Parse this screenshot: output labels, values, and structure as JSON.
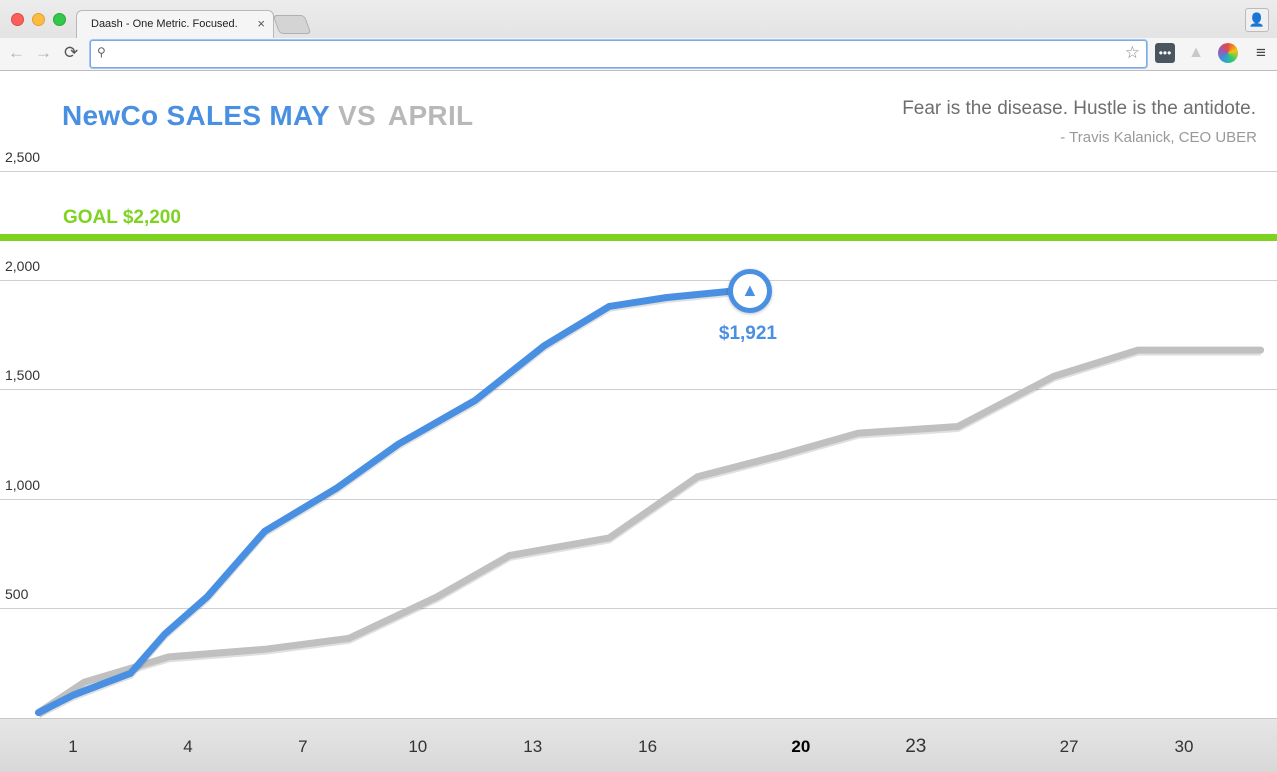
{
  "browser": {
    "tab_title": "Daash - One Metric. Focused.",
    "tab_close": "×",
    "address_value": "",
    "nav": {
      "back": "←",
      "forward": "→",
      "reload": "⟳"
    },
    "search_icon": "⚲",
    "star": "☆",
    "profile": "👤"
  },
  "dashboard": {
    "title_may": "NewCo SALES MAY",
    "title_vs": "VS",
    "title_april": "APRIL",
    "quote": "Fear is the disease.  Hustle is the antidote.",
    "author": "- Travis Kalanick, CEO UBER",
    "goal_label": "GOAL $2,200",
    "current_value": "$1,921",
    "current_arrow": "▲"
  },
  "colors": {
    "may": "#4a90e2",
    "april": "#c0c0c0",
    "goal": "#7ed321"
  },
  "chart_data": {
    "type": "line",
    "yticks": [
      "2,500",
      "2,000",
      "1,500",
      "1,000",
      "500"
    ],
    "ytick_values": [
      2500,
      2000,
      1500,
      1000,
      500
    ],
    "ylim": [
      0,
      2550
    ],
    "xlim": [
      0.1,
      32
    ],
    "xticks": [
      "1",
      "4",
      "7",
      "10",
      "13",
      "16",
      "20",
      "23",
      "27",
      "30"
    ],
    "xtick_values": [
      1,
      4,
      7,
      10,
      13,
      16,
      20,
      23,
      27,
      30
    ],
    "today": "20",
    "goal": 2200,
    "series": [
      {
        "name": "MAY",
        "x": [
          0.1,
          1,
          2.5,
          3.4,
          4.5,
          6,
          7.9,
          9.5,
          11.5,
          13.3,
          15,
          16.5,
          18.2
        ],
        "y": [
          20,
          100,
          200,
          380,
          550,
          850,
          1050,
          1250,
          1450,
          1700,
          1880,
          1921,
          1950
        ]
      },
      {
        "name": "APRIL",
        "x": [
          0.1,
          1.3,
          3.5,
          6,
          8.2,
          10.5,
          12.4,
          15,
          17.3,
          19.5,
          21.5,
          24.1,
          26.6,
          28.8,
          30.5,
          32
        ],
        "y": [
          20,
          160,
          275,
          310,
          360,
          550,
          740,
          820,
          1100,
          1200,
          1300,
          1330,
          1560,
          1680,
          1680,
          1680
        ]
      }
    ]
  }
}
